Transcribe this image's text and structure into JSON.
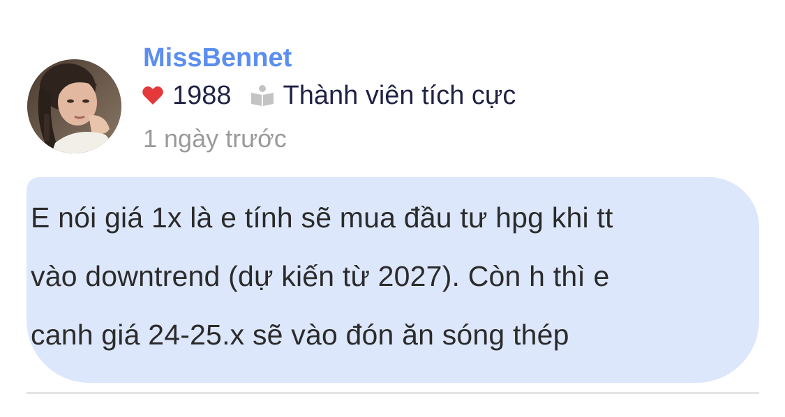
{
  "post": {
    "author": {
      "username": "MissBennet",
      "avatar_icon": "profile-photo"
    },
    "stats": {
      "likes": "1988",
      "heart_icon": "heart-icon",
      "heart_color": "#e5383b",
      "rank_icon": "book-icon",
      "rank": "Thành viên tích cực"
    },
    "timestamp": "1 ngày trước",
    "message": "E nói giá 1x là e tính sẽ mua đầu tư hpg khi tt\nvào downtrend (dự kiến từ 2027). Còn h thì e\ncanh giá 24-25.x sẽ vào đón ăn sóng thép",
    "colors": {
      "username": "#5b8ef0",
      "bubble_bg": "#dce7fb",
      "timestamp": "#9a9a9a"
    }
  }
}
